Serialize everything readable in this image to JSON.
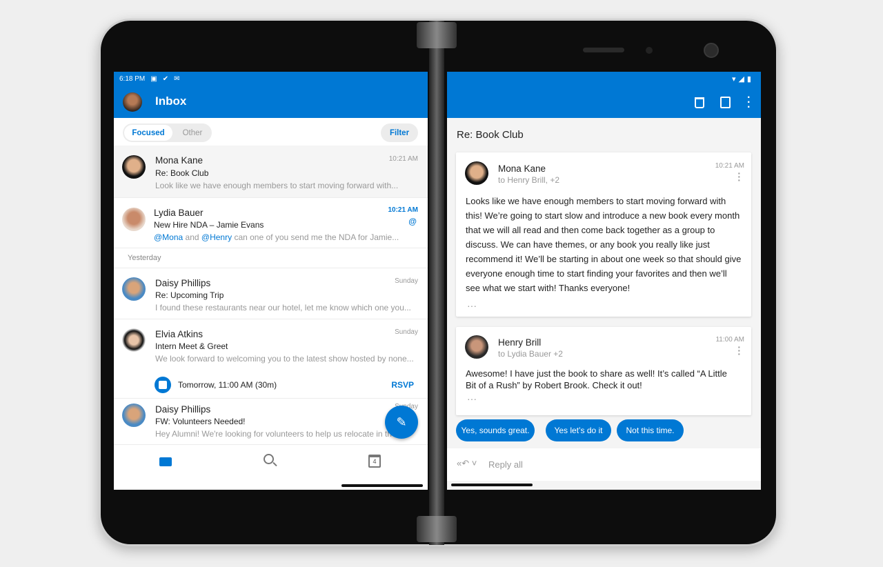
{
  "status_left": {
    "time": "6:18 PM"
  },
  "inbox": {
    "title": "Inbox",
    "tabs": [
      "Focused",
      "Other"
    ],
    "filter": "Filter",
    "section_yesterday": "Yesterday",
    "messages": [
      {
        "sender": "Mona Kane",
        "subject": "Re: Book Club",
        "preview": "Look like we have enough members to start moving forward with...",
        "time": "10:21 AM"
      },
      {
        "sender": "Lydia Bauer",
        "subject": "New Hire NDA – Jamie Evans",
        "mention1": "@Mona",
        "and": " and ",
        "mention2": "@Henry",
        "preview": " can one of you send me the NDA for Jamie...",
        "time": "10:21 AM",
        "badge": "@"
      },
      {
        "sender": "Daisy Phillips",
        "subject": "Re: Upcoming Trip",
        "preview": "I found these restaurants near our hotel, let me know which one you...",
        "time": "Sunday"
      },
      {
        "sender": "Elvia Atkins",
        "subject": "Intern Meet & Greet",
        "preview": "We look forward to welcoming you to the latest show hosted by none...",
        "time": "Sunday",
        "event": "Tomorrow, 11:00 AM (30m)",
        "rsvp": "RSVP"
      },
      {
        "sender": "Daisy Phillips",
        "subject": "FW: Volunteers Needed!",
        "preview": "Hey Alumni! We're looking for volunteers to help us relocate in the",
        "time": "Sunday"
      }
    ],
    "calendar_day": "4"
  },
  "thread": {
    "title": "Re: Book Club",
    "messages": [
      {
        "sender": "Mona Kane",
        "to": "to Henry Brill, +2",
        "time": "10:21 AM",
        "body": "Looks like we have enough members to start moving forward with this! We’re going to start slow and introduce a new book every month that we will all read and then come back together as a group to discuss. We can have themes, or any book you really like just recommend it! We’ll be starting in about one week so that should give everyone enough time to start finding your favorites and then we’ll see what we start with! Thanks everyone!",
        "more": "···"
      },
      {
        "sender": "Henry Brill",
        "to": "to Lydia Bauer +2",
        "time": "11:00 AM",
        "body": "Awesome! I have just the book to share as well! It’s called “A Little Bit of a Rush” by Robert Brook. Check it out!",
        "more": "···"
      }
    ],
    "suggested_replies": [
      "Yes, sounds great.",
      "Yes let’s do it",
      "Not this time."
    ],
    "reply_all": "Reply all"
  },
  "colors": {
    "accent": "#0078d4"
  }
}
